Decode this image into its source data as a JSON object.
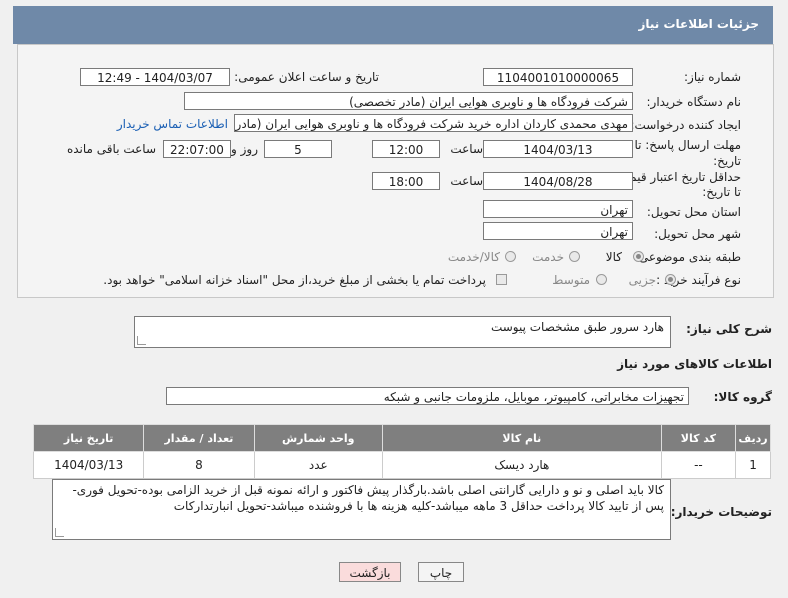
{
  "header": {
    "title": "جزئیات اطلاعات نیاز"
  },
  "form": {
    "need_number_label": "شماره نیاز:",
    "need_number": "1104001010000065",
    "announce_label": "تاریخ و ساعت اعلان عمومی:",
    "announce_value": "1404/03/07 - 12:49",
    "buyer_org_label": "نام دستگاه خریدار:",
    "buyer_org": "شرکت فرودگاه ها و ناوبری هوایی ایران (مادر تخصصی)",
    "requester_label": "ایجاد کننده درخواست:",
    "requester": "مهدی محمدی کاردان اداره خرید شرکت فرودگاه ها و ناوبری هوایی ایران (مادر تخ",
    "contact_link": "اطلاعات تماس خریدار",
    "deadline_label_1": "مهلت ارسال پاسخ: تا",
    "deadline_label_2": "تاریخ:",
    "deadline_date": "1404/03/13",
    "time_label": "ساعت",
    "deadline_time": "12:00",
    "days": "5",
    "days_label": "روز و",
    "remaining_time": "22:07:00",
    "remaining_label": "ساعت باقی مانده",
    "validity_label_1": "حداقل تاریخ اعتبار قیمت:",
    "validity_label_2": "تا تاریخ:",
    "validity_date": "1404/08/28",
    "validity_time": "18:00",
    "province_label": "استان محل تحویل:",
    "province": "تهران",
    "city_label": "شهر محل تحویل:",
    "city": "تهران",
    "category_label": "طبقه بندی موضوعی:",
    "category_options": [
      "کالا",
      "خدمت",
      "کالا/خدمت"
    ],
    "process_label": "نوع فرآیند خرید :",
    "process_options": [
      "جزیی",
      "متوسط"
    ],
    "payment_note": "پرداخت تمام یا بخشی از مبلغ خرید،از محل \"اسناد خزانه اسلامی\" خواهد بود."
  },
  "summary": {
    "label": "شرح کلی نیاز:",
    "value": "هارد سرور طبق مشخصات پیوست"
  },
  "goods": {
    "section_title": "اطلاعات کالاهای مورد نیاز",
    "group_label": "گروه کالا:",
    "group_value": "تجهیزات مخابراتی، کامپیوتر، موبایل، ملزومات جانبی و شبکه",
    "columns": [
      "ردیف",
      "کد کالا",
      "نام کالا",
      "واحد شمارش",
      "تعداد / مقدار",
      "تاریخ نیاز"
    ],
    "rows": [
      [
        "1",
        "--",
        "هارد دیسک",
        "عدد",
        "8",
        "1404/03/13"
      ]
    ]
  },
  "notes": {
    "label": "توضیحات خریدار:",
    "value": "کالا باید اصلی و نو و دارایی گارانتی اصلی باشد.بارگذار پیش فاکتور و ارائه نمونه قبل از خرید الزامی بوده-تحویل فوری-پس از تایید کالا پرداخت حداقل 3 ماهه میباشد-کلیه هزینه ها با فروشنده میباشد-تحویل انبارتدارکات"
  },
  "buttons": {
    "print": "چاپ",
    "back": "بازگشت"
  },
  "colors": {
    "title_bar": "#6f89a8",
    "table_header": "#7f7f7f",
    "link": "#1a5fb4"
  }
}
